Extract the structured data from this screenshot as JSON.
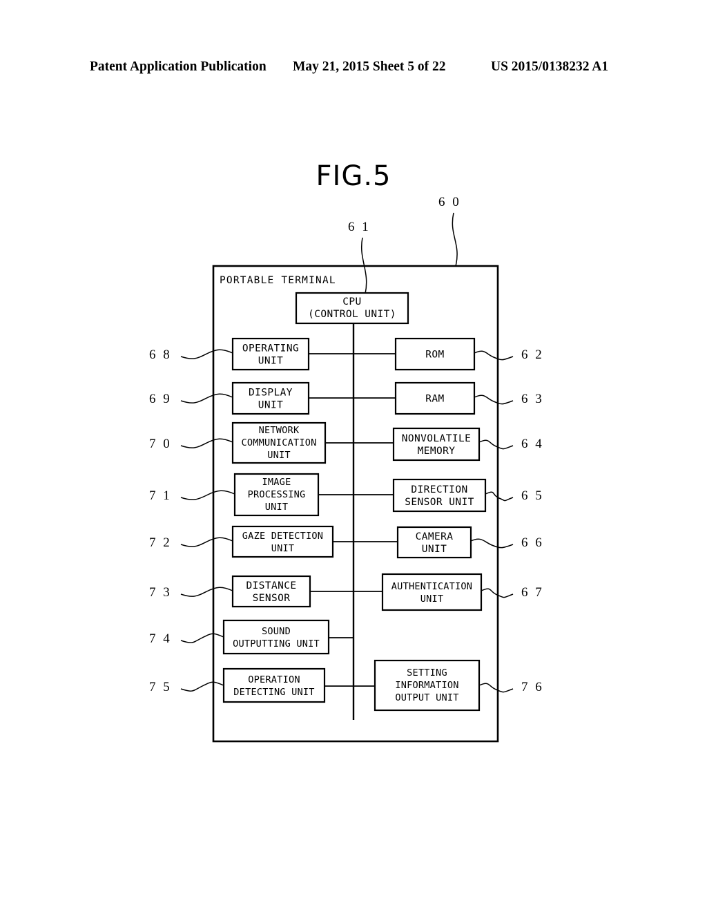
{
  "header": {
    "publication": "Patent Application Publication",
    "date_sheet": "May 21, 2015  Sheet 5 of 22",
    "doc_number": "US 2015/0138232 A1"
  },
  "figure": {
    "title": "FIG.5",
    "frame_label": "PORTABLE TERMINAL",
    "frame_ref": "6 0",
    "cpu_ref": "6 1",
    "cpu": {
      "line1": "CPU",
      "line2": "(CONTROL UNIT)"
    },
    "left_blocks": [
      {
        "ref": "6 8",
        "lines": [
          "OPERATING",
          "UNIT"
        ]
      },
      {
        "ref": "6 9",
        "lines": [
          "DISPLAY",
          "UNIT"
        ]
      },
      {
        "ref": "7 0",
        "lines": [
          "NETWORK",
          "COMMUNICATION",
          "UNIT"
        ]
      },
      {
        "ref": "7 1",
        "lines": [
          "IMAGE",
          "PROCESSING",
          "UNIT"
        ]
      },
      {
        "ref": "7 2",
        "lines": [
          "GAZE DETECTION",
          "UNIT"
        ]
      },
      {
        "ref": "7 3",
        "lines": [
          "DISTANCE",
          "SENSOR"
        ]
      },
      {
        "ref": "7 4",
        "lines": [
          "SOUND",
          "OUTPUTTING UNIT"
        ]
      },
      {
        "ref": "7 5",
        "lines": [
          "OPERATION",
          "DETECTING UNIT"
        ]
      }
    ],
    "right_blocks": [
      {
        "ref": "6 2",
        "lines": [
          "ROM"
        ]
      },
      {
        "ref": "6 3",
        "lines": [
          "RAM"
        ]
      },
      {
        "ref": "6 4",
        "lines": [
          "NONVOLATILE",
          "MEMORY"
        ]
      },
      {
        "ref": "6 5",
        "lines": [
          "DIRECTION",
          "SENSOR UNIT"
        ]
      },
      {
        "ref": "6 6",
        "lines": [
          "CAMERA",
          "UNIT"
        ]
      },
      {
        "ref": "6 7",
        "lines": [
          "AUTHENTICATION",
          "UNIT"
        ]
      },
      {
        "ref": "7 6",
        "lines": [
          "SETTING",
          "INFORMATION",
          "OUTPUT UNIT"
        ]
      }
    ]
  }
}
